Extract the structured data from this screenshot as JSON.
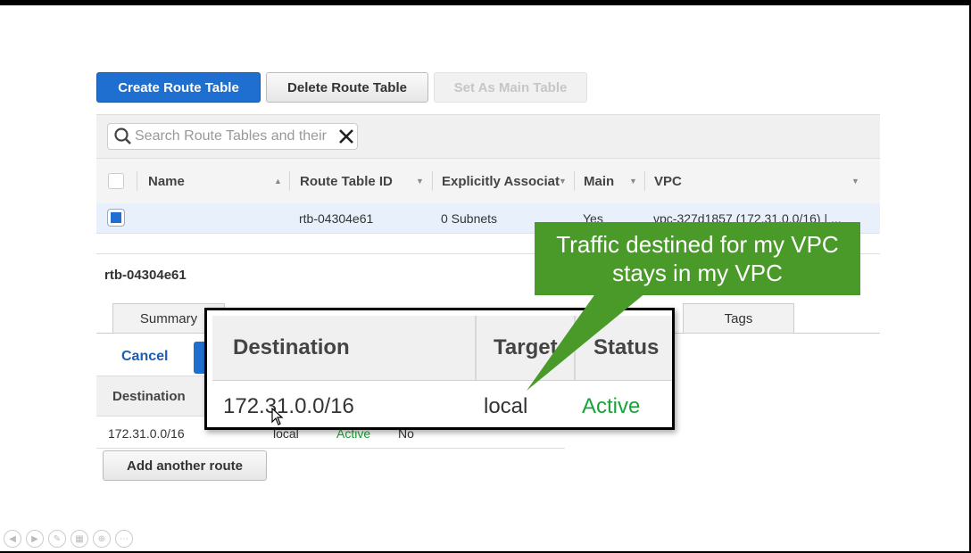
{
  "toolbar": {
    "create_label": "Create Route Table",
    "delete_label": "Delete Route Table",
    "set_main_label": "Set As Main Table"
  },
  "search": {
    "placeholder": "Search Route Tables and their"
  },
  "table": {
    "headers": [
      "Name",
      "Route Table ID",
      "Explicitly Associat",
      "Main",
      "VPC"
    ],
    "rows": [
      {
        "name": "",
        "id": "rtb-04304e61",
        "assoc": "0 Subnets",
        "main": "Yes",
        "vpc": "vpc-327d1857 (172.31.0.0/16) | ..."
      }
    ]
  },
  "detail": {
    "title": "rtb-04304e61",
    "tabs": [
      "Summary",
      "Tags"
    ],
    "cancel_label": "Cancel",
    "sub_header": "Destination",
    "route": {
      "destination": "172.31.0.0/16",
      "target": "local",
      "status": "Active",
      "propagated": "No"
    },
    "add_label": "Add another route"
  },
  "zoom": {
    "headers": [
      "Destination",
      "Target",
      "Status"
    ],
    "destination": "172.31.0.0/16",
    "target": "local",
    "status": "Active"
  },
  "callout": {
    "line1": "Traffic destined for my VPC",
    "line2": "stays in my VPC"
  },
  "colors": {
    "accent": "#1f6fd0",
    "callout": "#4a9a2a",
    "active": "#1aa33a"
  }
}
